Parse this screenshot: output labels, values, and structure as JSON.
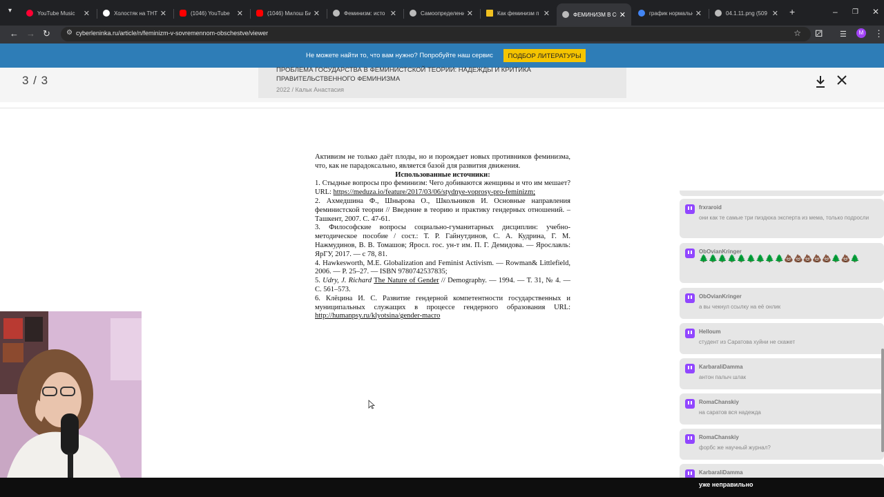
{
  "browser": {
    "tabs": [
      {
        "title": "YouTube Music",
        "favicon_color": "#ff0033"
      },
      {
        "title": "Холостяк на ТНТ",
        "favicon_color": "#ffffff"
      },
      {
        "title": "(1046) YouTube",
        "favicon_color": "#ff0000"
      },
      {
        "title": "(1046) Милош Би",
        "favicon_color": "#ff0000"
      },
      {
        "title": "Феминизм: исто",
        "favicon_color": "#bbbbbb"
      },
      {
        "title": "Самоопределени",
        "favicon_color": "#bbbbbb"
      },
      {
        "title": "Как феминизм п",
        "favicon_color": "#f0c020"
      },
      {
        "title": "ФЕМИНИЗМ В СС",
        "favicon_color": "#bbbbbb"
      },
      {
        "title": "график нормальн",
        "favicon_color": "#4285f4"
      },
      {
        "title": "04.1.11.png (509",
        "favicon_color": "#bbbbbb"
      }
    ],
    "active_tab_index": 7,
    "url": "cyberleninka.ru/article/n/feminizm-v-sovremennom-obschestve/viewer",
    "profile_initial": "M"
  },
  "banner": {
    "text": "Не можете найти то, что вам нужно? Попробуйте наш сервис",
    "button_label": "ПОДБОР ЛИТЕРАТУРЫ"
  },
  "viewer": {
    "page_indicator": "3 / 3",
    "related_title": "ПРОБЛЕМА ГОСУДАРСТВА В ФЕМИНИСТСКОЙ ТЕОРИИ: НАДЕЖДЫ И КРИТИКА ПРАВИТЕЛЬСТВЕННОГО ФЕМИНИЗМА",
    "related_meta": "2022 / Кальк Анастасия"
  },
  "document": {
    "intro": "Активизм не только даёт плоды, но и порождает новых противников феминизма, что, как не парадоксально, является базой для развития движения.",
    "heading": "Использованные источники:",
    "sources": {
      "s1_text": "1. Стыдные вопросы про феминизм: Чего добиваются женщины и что им мешает? URL: ",
      "s1_link": "https://meduza.io/feature/2017/03/06/stydnye-voprosy-pro-feminizm;",
      "s2": "2. Ахмедшина Ф., Шнырова О., Школьников И. Основные направления феминистской теории // Введение в теорию и практику гендерных отношений. – Ташкент, 2007. С. 47-61.",
      "s3": "3. Философские вопросы социально-гуманитарных дисциплин: учебно-методическое пособие / сост.: Т. Р. Гайнутдинов, С. А. Кудрина, Г. М. Нажмудинов, В. В. Томашов; Яросл. гос. ун-т им. П. Г. Демидова. — Ярославль: ЯрГУ, 2017. — с 78, 81.",
      "s4": "4. Hawkesworth, M.E. Globalization and Feminist Activism. — Rowman& Littlefield, 2006. — P. 25–27. — ISBN 9780742537835;",
      "s5_num": "5. ",
      "s5_author": "Udry, J. Richard",
      "s5_title": "The Nature of Gender",
      "s5_rest": " // Demography. — 1994. — Т. 31, № 4. — С. 561–573.",
      "s6_text": "6. Клёцина И. С. Развитие гендерной компетентности государственных и муниципальных служащих в процессе гендерного образования URL: ",
      "s6_link": "http://humanpsy.ru/klyotsina/gender-macro"
    }
  },
  "chat": {
    "messages": [
      {
        "user": "frxraroid",
        "text": "они как те самые три пиздюка эксперта из мема, только подросли"
      },
      {
        "user": "ObOvianKringer",
        "emotes": "🌲🌲🌲🌲🌲🌲🌲🌲🌲💩💩💩💩💩🌲💩🌲"
      },
      {
        "user": "ObOvianKringer",
        "text": "а вы чекнул ссылку на её онлик"
      },
      {
        "user": "Helloum",
        "text": "студент из Саратова хуйни не скажет"
      },
      {
        "user": "KarbaraliDamma",
        "text": "антон палыч шлак"
      },
      {
        "user": "RomaChanskiy",
        "text": "на саратов вся надежда"
      },
      {
        "user": "RomaChanskiy",
        "text": "форбс же научный журнал?"
      },
      {
        "user": "KarbaraliDamma",
        "text": ""
      }
    ]
  },
  "stream": {
    "caption": "уже неправильно"
  }
}
